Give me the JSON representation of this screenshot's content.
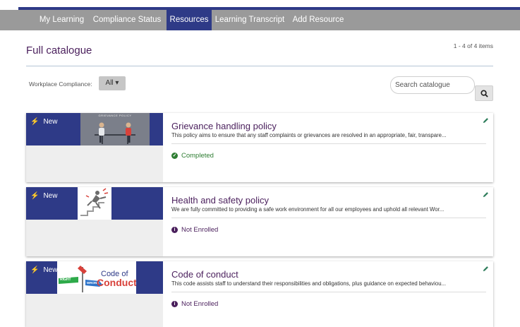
{
  "nav": {
    "tabs": [
      {
        "label": "My Learning"
      },
      {
        "label": "Compliance Status"
      },
      {
        "label": "Resources"
      },
      {
        "label": "Learning Transcript"
      },
      {
        "label": "Add Resource"
      }
    ],
    "active": "Resources"
  },
  "page": {
    "title": "Full catalogue",
    "count": "1 - 4 of 4 items"
  },
  "filter": {
    "label": "Workplace Compliance:",
    "value": "All ▾"
  },
  "search": {
    "placeholder": "Search catalogue"
  },
  "cards": [
    {
      "badge": "New",
      "title": "Grievance handling policy",
      "description": "This policy aims to ensure that any staff complaints or grievances are resolved in an appropriate, fair, transpare...",
      "status": "Completed",
      "thumb_caption": "GRIEVANCE POLICY"
    },
    {
      "badge": "New",
      "title": "Health and safety policy",
      "description": "We are fully committed to providing a safe work environment for all our employees and uphold all relevant Wor...",
      "status": "Not Enrolled"
    },
    {
      "badge": "New",
      "title": "Code of conduct",
      "description": "This code assists staff to understand their responsibilities and obligations, plus guidance on expected behaviou...",
      "status": "Not Enrolled",
      "thumb_line1": "Code of",
      "thumb_line2": "Conduct",
      "sign_right": "RIGHT",
      "sign_wrong": "WRONG"
    }
  ],
  "colors": {
    "nav_bg": "#9a9a9a",
    "accent": "#2e3a87",
    "title": "#4a1f5c",
    "completed": "#2e7d32",
    "not_enrolled": "#4a1f5c",
    "edit_icon": "#2e7d5b"
  },
  "icons": {
    "badge": "lightning-icon",
    "edit": "pencil-icon",
    "search": "search-icon",
    "completed": "check-circle-icon",
    "not_enrolled": "info-circle-icon"
  }
}
